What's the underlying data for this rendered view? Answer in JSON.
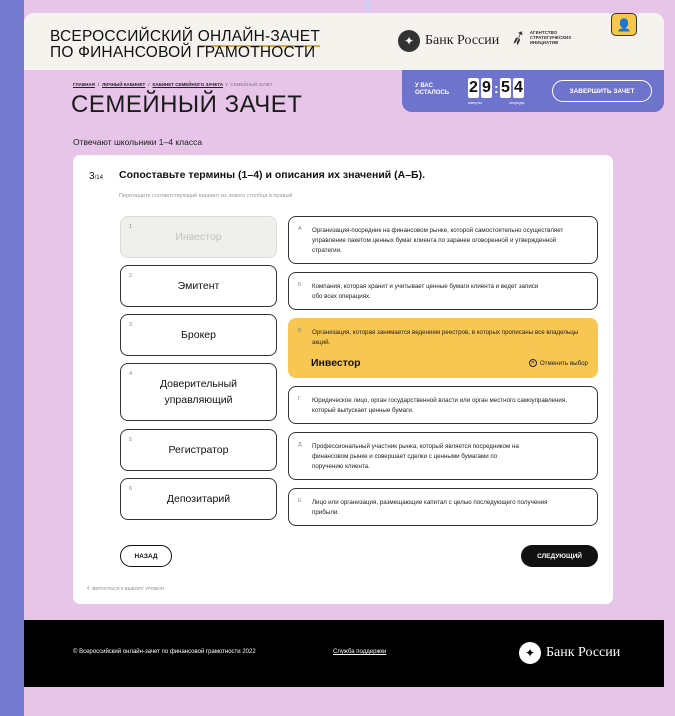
{
  "header": {
    "brand_line1_a": "ВСЕРОССИЙСКИЙ ",
    "brand_line1_b": "ОНЛАЙН-ЗАЧЕТ",
    "brand_line2": "ПО ФИНАНСОВОЙ ГРАМОТНОСТИ",
    "bank_name": "Банк России",
    "asi_text": "АГЕНТСТВО СТРАТЕГИЧЕСКИХ ИНИЦИАТИВ",
    "user_icon": "👤"
  },
  "breadcrumb": {
    "items": [
      "ГЛАВНАЯ",
      "ЛИЧНЫЙ КАБИНЕТ",
      "КАБИНЕТ СЕМЕЙНОГО ЗАЧЕТА"
    ],
    "current": "СЕМЕЙНЫЙ ЗАЧЕТ",
    "sep": "/"
  },
  "page": {
    "title": "СЕМЕЙНЫЙ ЗАЧЕТ",
    "subtitle": "Отвечают школьники 1–4 класса"
  },
  "timer": {
    "label": "У ВАС ОСТАЛОСЬ",
    "minutes": [
      "2",
      "9"
    ],
    "seconds": [
      "5",
      "4"
    ],
    "minutes_unit": "минуты",
    "seconds_unit": "секунды",
    "finish_label": "ЗАВЕРШИТЬ ЗАЧЕТ"
  },
  "question": {
    "number": "3",
    "total": "/14",
    "text": "Сопоставьте термины (1–4) и описания их значений (А–Б).",
    "hint": "Перетащите соответствующий вариант из левого столбца в правый"
  },
  "terms": [
    {
      "n": "1",
      "label": "Инвестор"
    },
    {
      "n": "2",
      "label": "Эмитент"
    },
    {
      "n": "3",
      "label": "Брокер"
    },
    {
      "n": "4",
      "label": "Доверительный управляющий"
    },
    {
      "n": "5",
      "label": "Регистратор"
    },
    {
      "n": "6",
      "label": "Депозитарий"
    }
  ],
  "descriptions": [
    {
      "letter": "А",
      "text": "Организация-посредник на финансовом рынке, которой самостоятельно осуществляет управление пакетом ценных бумаг клиента по заранее оговоренной и утвержденной стратегии."
    },
    {
      "letter": "Б",
      "text": "Компания, которая хранит и учитывает ценные бумаги клиента и ведет записи обо всех операциях."
    },
    {
      "letter": "В",
      "text": "Организация, которая занимается ведением реестров, в которых прописаны все владельцы акций.",
      "answer": "Инвестор",
      "cancel": "Отменить выбор"
    },
    {
      "letter": "Г",
      "text": "Юридическое лицо, орган государственной власти или орган местного самоуправления, который выпускает ценные бумаги."
    },
    {
      "letter": "Д",
      "text": "Профессиональный участник рынка, который является посредником на финансовом рынке и совершает сделки с ценными бумагами по поручению клиента."
    },
    {
      "letter": "Е",
      "text": "Лицо или организация, размещающие капитал с целью последующего получения прибыли."
    }
  ],
  "nav": {
    "back": "НАЗАД",
    "next": "СЛЕДУЮЩИЙ",
    "return_level": "ВЕРНУТЬСЯ К ВЫБОРУ УРОВНЯ"
  },
  "footer": {
    "copyright": "© Всероссийский онлайн-зачет по финансовой грамотности 2022",
    "support": "Служба поддержки",
    "bank_name": "Банк России"
  },
  "colors": {
    "accent_yellow": "#f8c752",
    "timer_bg": "#6e73cb",
    "page_bg": "#e6c5e8"
  }
}
